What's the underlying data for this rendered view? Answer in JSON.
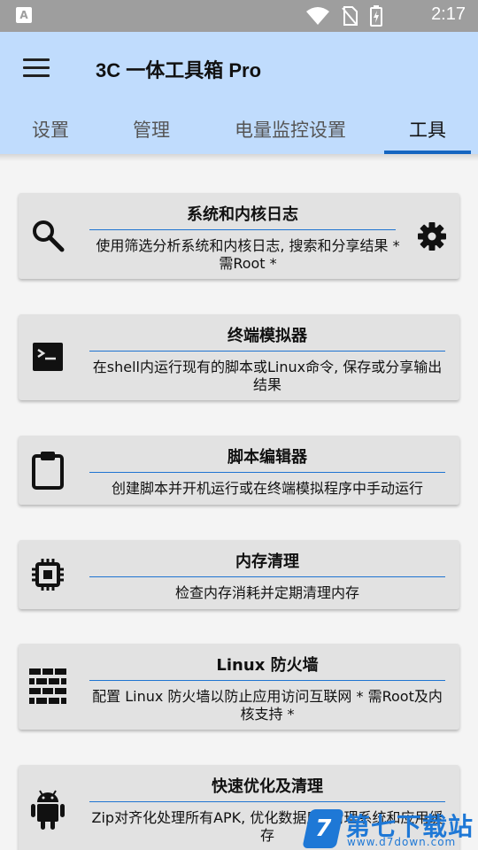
{
  "status_bar": {
    "time": "2:17",
    "icons": [
      "notification-a-icon",
      "wifi-icon",
      "no-sim-icon",
      "battery-charging-icon"
    ]
  },
  "app_bar": {
    "title": "3C 一体工具箱 Pro",
    "menu_icon": "hamburger-menu-icon"
  },
  "tabs": [
    {
      "label": "设置",
      "active": false
    },
    {
      "label": "管理",
      "active": false
    },
    {
      "label": "电量监控设置",
      "active": false
    },
    {
      "label": "工具",
      "active": true
    }
  ],
  "accent_color": "#1565c0",
  "cards": [
    {
      "title": "系统和内核日志",
      "description": "使用筛选分析系统和内核日志, 搜索和分享结果 * 需Root *",
      "icon": "search-icon",
      "settings_icon": "gear-icon"
    },
    {
      "title": "终端模拟器",
      "description": "在shell内运行现有的脚本或Linux命令, 保存或分享输出结果",
      "icon": "terminal-icon"
    },
    {
      "title": "脚本编辑器",
      "description": "创建脚本并开机运行或在终端模拟程序中手动运行",
      "icon": "clipboard-icon"
    },
    {
      "title": "内存清理",
      "description": "检查内存消耗并定期清理内存",
      "icon": "chip-icon"
    },
    {
      "title": "Linux 防火墙",
      "description": "配置 Linux 防火墙以防止应用访问互联网 * 需Root及内核支持 *",
      "icon": "brick-wall-icon"
    },
    {
      "title": "快速优化及清理",
      "description": "Zip对齐化处理所有APK, 优化数据库, 清理系统和应用缓存",
      "icon": "android-icon"
    }
  ],
  "watermark": {
    "badge": "7",
    "text": "第七下载站",
    "url": "www.d7down.com"
  }
}
